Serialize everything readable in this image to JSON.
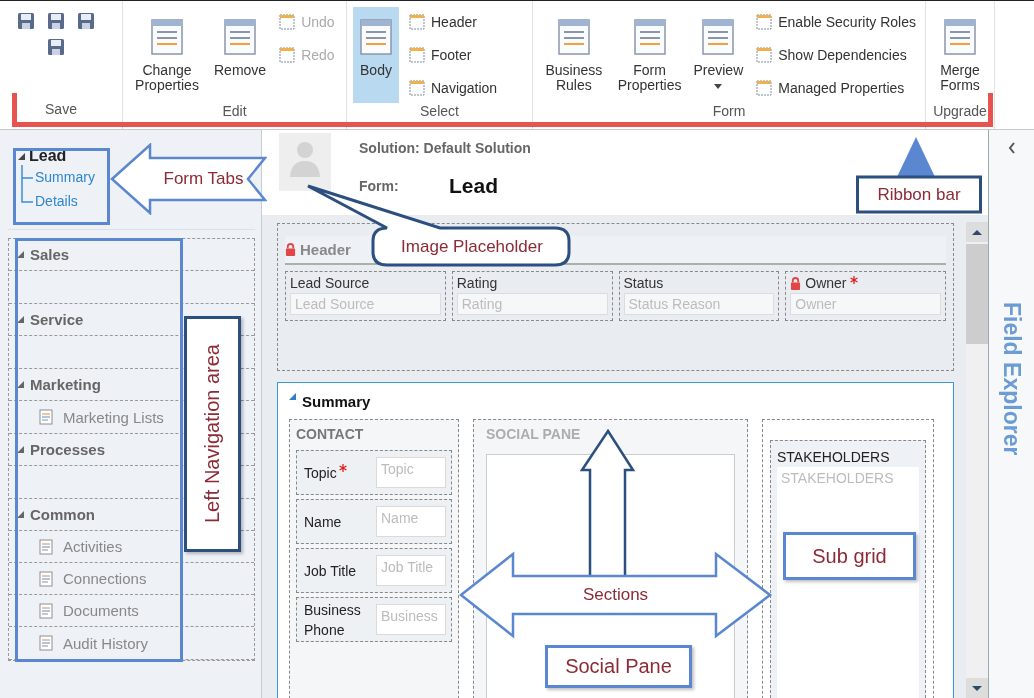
{
  "ribbon": {
    "groups": [
      {
        "kind": "icons",
        "label": "Save"
      },
      {
        "kind": "buttons",
        "label": "Edit",
        "buttons": [
          {
            "kind": "large",
            "label": "Change Properties",
            "disabled": false
          },
          {
            "kind": "large",
            "label": "Remove",
            "disabled": false
          },
          {
            "kind": "small",
            "label": "Undo",
            "disabled": true
          },
          {
            "kind": "small",
            "label": "Redo",
            "disabled": true
          }
        ]
      },
      {
        "kind": "buttons",
        "label": "Select",
        "buttons": [
          {
            "kind": "large",
            "label": "Body",
            "selected": true
          },
          {
            "kind": "small",
            "label": "Header",
            "selected": false
          },
          {
            "kind": "small",
            "label": "Footer",
            "selected": false
          },
          {
            "kind": "small",
            "label": "Navigation",
            "selected": false
          }
        ]
      },
      {
        "kind": "buttons",
        "label": "Form",
        "buttons": [
          {
            "kind": "large",
            "label": "Business Rules",
            "dropdown": false
          },
          {
            "kind": "large",
            "label": "Form Properties",
            "dropdown": false
          },
          {
            "kind": "large",
            "label": "Preview",
            "dropdown": true
          },
          {
            "kind": "small",
            "label": "Enable Security Roles"
          },
          {
            "kind": "small",
            "label": "Show Dependencies"
          },
          {
            "kind": "small",
            "label": "Managed Properties"
          }
        ]
      },
      {
        "kind": "buttons",
        "label": "Upgrade",
        "buttons": [
          {
            "kind": "large",
            "label": "Merge Forms"
          }
        ]
      }
    ]
  },
  "left_nav": {
    "title": "Lead",
    "tabs": [
      {
        "label": "Summary"
      },
      {
        "label": "Details"
      }
    ],
    "groups": [
      {
        "label": "Sales"
      },
      {
        "label": "Service"
      },
      {
        "label": "Marketing",
        "items": [
          {
            "label": "Marketing Lists"
          }
        ]
      },
      {
        "label": "Processes"
      },
      {
        "label": "Common",
        "items": [
          {
            "label": "Activities"
          },
          {
            "label": "Connections"
          },
          {
            "label": "Documents"
          },
          {
            "label": "Audit History"
          }
        ]
      }
    ]
  },
  "form": {
    "solution": "Solution: Default Solution",
    "form_label": "Form:",
    "form_name": "Lead",
    "header": {
      "title": "Header",
      "locked": true,
      "fields": [
        {
          "label": "Lead Source",
          "placeholder": "Lead Source",
          "locked": false,
          "required": false
        },
        {
          "label": "Rating",
          "placeholder": "Rating",
          "locked": false,
          "required": false
        },
        {
          "label": "Status",
          "placeholder": "Status Reason",
          "locked": false,
          "required": false
        },
        {
          "label": "Owner",
          "placeholder": "Owner",
          "locked": true,
          "required": true
        }
      ]
    },
    "tab": {
      "title": "Summary",
      "sections": [
        {
          "kind": "fields",
          "title": "CONTACT",
          "fields": [
            {
              "label": "Topic",
              "placeholder": "Topic",
              "required": true
            },
            {
              "label": "Name",
              "placeholder": "Name",
              "required": false
            },
            {
              "label": "Job Title",
              "placeholder": "Job Title",
              "required": false
            },
            {
              "label": "Business Phone",
              "placeholder": "Business",
              "required": false
            }
          ]
        },
        {
          "kind": "social",
          "title": "SOCIAL PANE"
        },
        {
          "kind": "subgrid",
          "title": "STAKEHOLDERS",
          "placeholder": "STAKEHOLDERS"
        }
      ]
    }
  },
  "field_explorer": {
    "title": "Field Explorer"
  },
  "annotations": [
    {
      "kind": "arrow",
      "text": "Form Tabs"
    },
    {
      "kind": "speech",
      "text": "Image Placeholder"
    },
    {
      "kind": "pointer-box",
      "text": "Ribbon bar"
    },
    {
      "kind": "vertical-box",
      "text": "Left Navigation area"
    },
    {
      "kind": "double-arrow",
      "text": "Sections"
    },
    {
      "kind": "box",
      "text": "Sub grid"
    },
    {
      "kind": "box",
      "text": "Social Pane"
    }
  ]
}
